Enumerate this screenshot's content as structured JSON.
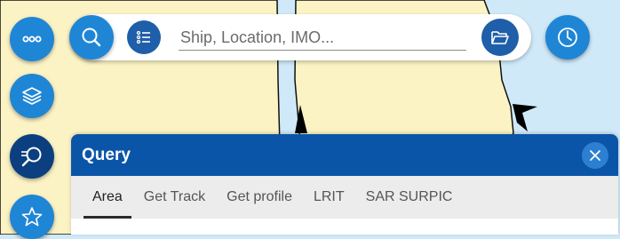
{
  "search": {
    "placeholder": "Ship, Location, IMO..."
  },
  "panel": {
    "title": "Query",
    "tabs": [
      {
        "label": "Area",
        "active": true
      },
      {
        "label": "Get Track",
        "active": false
      },
      {
        "label": "Get profile",
        "active": false
      },
      {
        "label": "LRIT",
        "active": false
      },
      {
        "label": "SAR SURPIC",
        "active": false
      }
    ]
  },
  "colors": {
    "water": "#cfe9f8",
    "land": "#fbf3c4",
    "accent": "#1f86d6",
    "panel_header": "#0b55a8",
    "fab_active": "#0b3f7f"
  },
  "icons": {
    "menu": "more-dots-icon",
    "layers": "layers-icon",
    "query": "query-search-icon",
    "favorites": "star-icon",
    "search": "search-icon",
    "list": "list-icon",
    "folder": "folder-open-icon",
    "history": "clock-icon",
    "close": "close-icon"
  }
}
